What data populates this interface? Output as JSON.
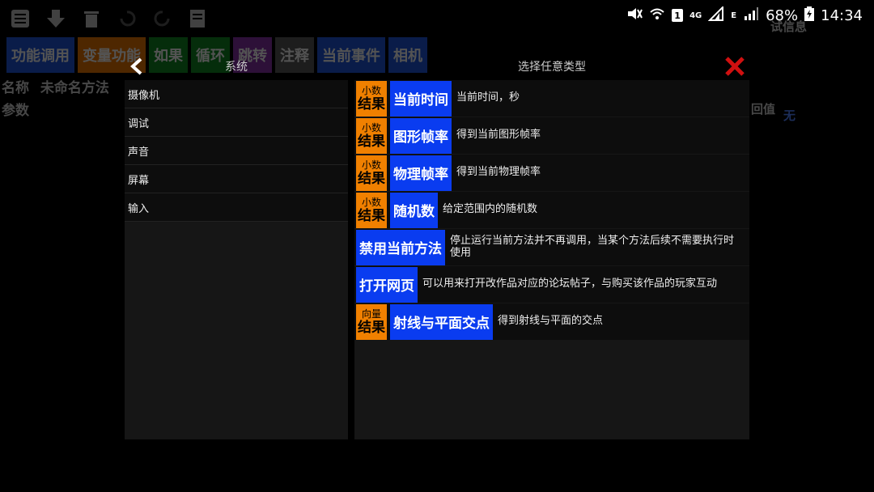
{
  "status": {
    "network": "4G",
    "network2": "E",
    "sim": "1",
    "battery": "68%",
    "time": "14:34"
  },
  "background": {
    "tabs": [
      "功能调用",
      "变量功能",
      "如果",
      "循环",
      "跳转",
      "注释",
      "当前事件",
      "相机"
    ],
    "name_label": "名称",
    "name_value": "未命名方法",
    "params_label": "参数",
    "return_label": "回值",
    "return_value": "无",
    "right_label": "试信息"
  },
  "dialog": {
    "left_title": "系统",
    "right_title": "选择任意类型",
    "categories": [
      "摄像机",
      "调试",
      "声音",
      "屏幕",
      "输入"
    ],
    "functions": [
      {
        "badge_top": "小数",
        "badge_bottom": "结果",
        "name": "当前时间",
        "desc": "当前时间，秒"
      },
      {
        "badge_top": "小数",
        "badge_bottom": "结果",
        "name": "图形帧率",
        "desc": "得到当前图形帧率"
      },
      {
        "badge_top": "小数",
        "badge_bottom": "结果",
        "name": "物理帧率",
        "desc": "得到当前物理帧率"
      },
      {
        "badge_top": "小数",
        "badge_bottom": "结果",
        "name": "随机数",
        "desc": "给定范围内的随机数"
      },
      {
        "name": "禁用当前方法",
        "desc": "停止运行当前方法并不再调用，当某个方法后续不需要执行时使用"
      },
      {
        "name": "打开网页",
        "desc": "可以用来打开改作品对应的论坛帖子，与购买该作品的玩家互动"
      },
      {
        "badge_top": "向量",
        "badge_bottom": "结果",
        "name": "射线与平面交点",
        "desc": "得到射线与平面的交点"
      }
    ]
  },
  "colors": {
    "accent_blue": "#0a3cf0",
    "badge_orange": "#f08000",
    "close_red": "#d01010"
  }
}
